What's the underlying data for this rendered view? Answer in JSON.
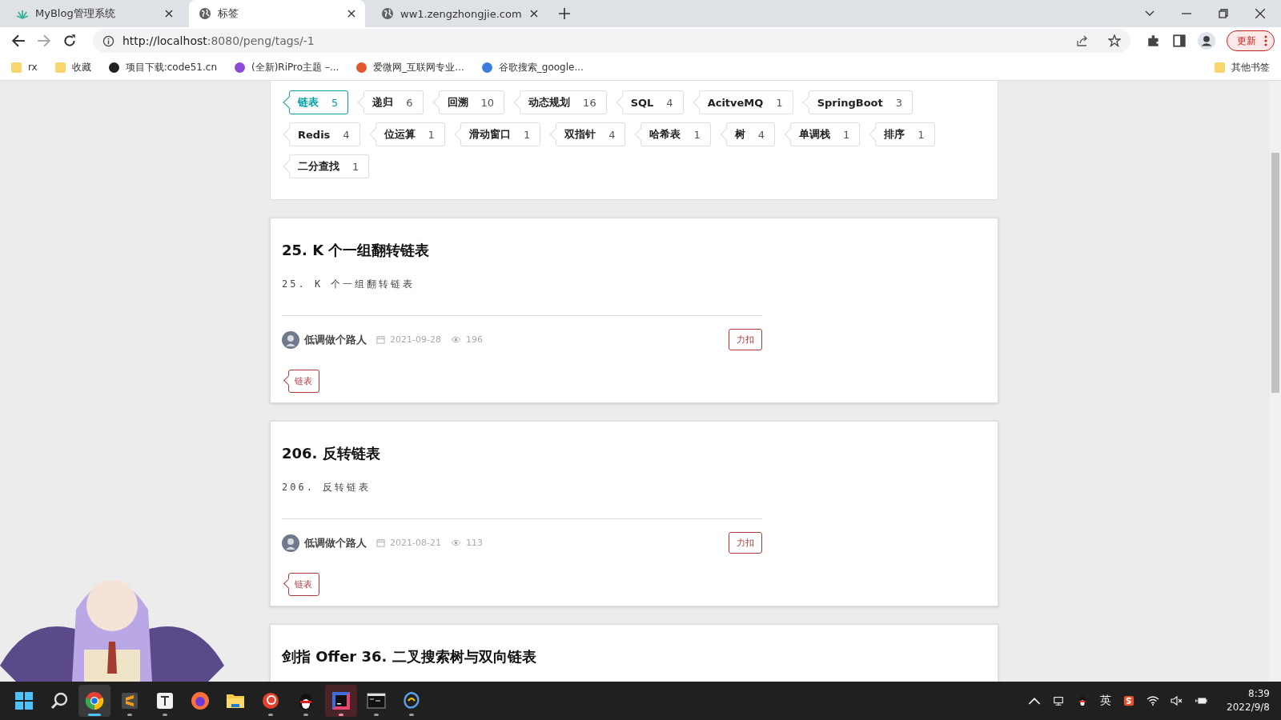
{
  "browser": {
    "tabs": [
      {
        "title": "MyBlog管理系统",
        "selected": false
      },
      {
        "title": "标签",
        "selected": true
      },
      {
        "title": "ww1.zengzhongjie.com",
        "selected": false
      }
    ],
    "address": {
      "host": "http://localhost",
      "rest": ":8080/peng/tags/-1"
    },
    "update_button": "更新",
    "bookmarks": [
      {
        "label": "rx"
      },
      {
        "label": "收藏"
      },
      {
        "label": "项目下载:code51.cn"
      },
      {
        "label": "(全新)RiPro主题 –..."
      },
      {
        "label": "爱微网_互联网专业..."
      },
      {
        "label": "谷歌搜索_google..."
      }
    ],
    "other_bookmarks": "其他书签"
  },
  "tags": [
    {
      "label": "链表",
      "count": "5",
      "selected": true
    },
    {
      "label": "递归",
      "count": "6",
      "selected": false
    },
    {
      "label": "回溯",
      "count": "10",
      "selected": false
    },
    {
      "label": "动态规划",
      "count": "16",
      "selected": false
    },
    {
      "label": "SQL",
      "count": "4",
      "selected": false
    },
    {
      "label": "AcitveMQ",
      "count": "1",
      "selected": false
    },
    {
      "label": "SpringBoot",
      "count": "3",
      "selected": false
    },
    {
      "label": "Redis",
      "count": "4",
      "selected": false
    },
    {
      "label": "位运算",
      "count": "1",
      "selected": false
    },
    {
      "label": "滑动窗口",
      "count": "1",
      "selected": false
    },
    {
      "label": "双指针",
      "count": "4",
      "selected": false
    },
    {
      "label": "哈希表",
      "count": "1",
      "selected": false
    },
    {
      "label": "树",
      "count": "4",
      "selected": false
    },
    {
      "label": "单调栈",
      "count": "1",
      "selected": false
    },
    {
      "label": "排序",
      "count": "1",
      "selected": false
    },
    {
      "label": "二分查找",
      "count": "1",
      "selected": false
    }
  ],
  "articles": [
    {
      "title": "25. K 个一组翻转链表",
      "excerpt": "25. K 个一组翻转链表",
      "author": "低调做个路人",
      "date": "2021-09-28",
      "views": "196",
      "category": "力扣",
      "tags": [
        "链表"
      ]
    },
    {
      "title": "206. 反转链表",
      "excerpt": "206. 反转链表",
      "author": "低调做个路人",
      "date": "2021-08-21",
      "views": "113",
      "category": "力扣",
      "tags": [
        "链表"
      ]
    },
    {
      "title": "剑指 Offer 36. 二叉搜索树与双向链表"
    }
  ],
  "taskbar": {
    "apps": [
      {
        "kind": "start",
        "running": false,
        "active": false,
        "flashing": false
      },
      {
        "kind": "search",
        "running": false,
        "active": false,
        "flashing": false
      },
      {
        "kind": "chrome",
        "running": true,
        "active": true,
        "flashing": false
      },
      {
        "kind": "sublime",
        "running": true,
        "active": false,
        "flashing": false
      },
      {
        "kind": "typora",
        "running": true,
        "active": false,
        "flashing": false
      },
      {
        "kind": "firefox",
        "running": false,
        "active": false,
        "flashing": false
      },
      {
        "kind": "folder",
        "running": false,
        "active": false,
        "flashing": false
      },
      {
        "kind": "swirl",
        "running": true,
        "active": false,
        "flashing": false
      },
      {
        "kind": "penguin",
        "running": true,
        "active": false,
        "flashing": false
      },
      {
        "kind": "ide",
        "running": true,
        "active": false,
        "flashing": true
      },
      {
        "kind": "terminal",
        "running": true,
        "active": false,
        "flashing": false
      },
      {
        "kind": "navicat",
        "running": true,
        "active": false,
        "flashing": false
      }
    ],
    "input_method": "英",
    "time": "8:39",
    "date": "2022/9/8"
  }
}
